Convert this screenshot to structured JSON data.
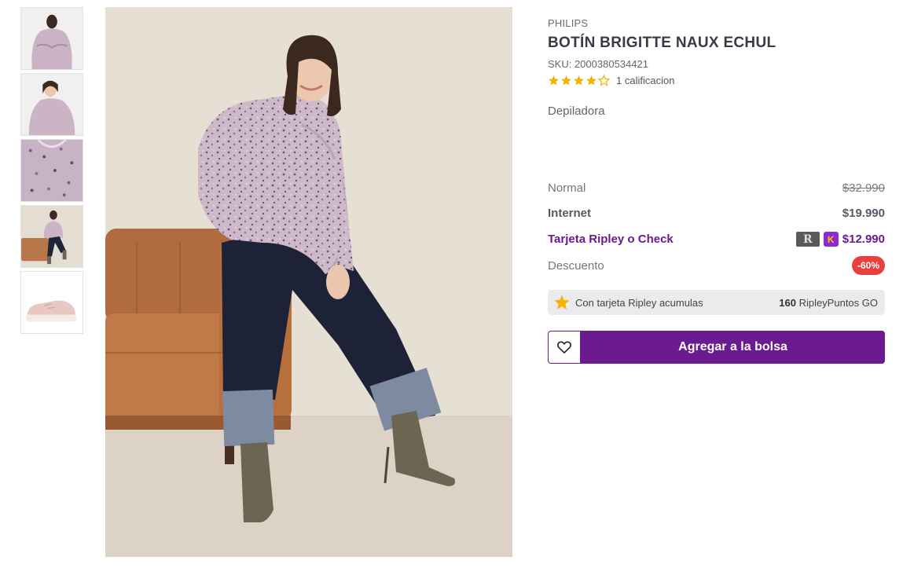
{
  "product": {
    "brand": "PHILIPS",
    "title": "BOTÍN BRIGITTE NAUX ECHUL",
    "sku": "SKU: 2000380534421",
    "rating_value": 4,
    "rating_max": 5,
    "rating_count": "1 calificacion",
    "subtitle": "Depiladora"
  },
  "prices": {
    "normal_label": "Normal",
    "normal_value": "$32.990",
    "internet_label": "Internet",
    "internet_value": "$19.990",
    "card_label": "Tarjeta Ripley o Check",
    "card_value": "$12.990",
    "discount_label": "Descuento",
    "discount_value": "-60%"
  },
  "points": {
    "text": "Con tarjeta Ripley acumulas",
    "amount": "160",
    "unit": "RipleyPuntos GO"
  },
  "actions": {
    "add_to_bag": "Agregar a la bolsa"
  },
  "icons": {
    "card_r": "R",
    "card_k": "K"
  },
  "colors": {
    "accent": "#6b1a8f",
    "discount": "#e8403c",
    "star": "#f5b301"
  }
}
